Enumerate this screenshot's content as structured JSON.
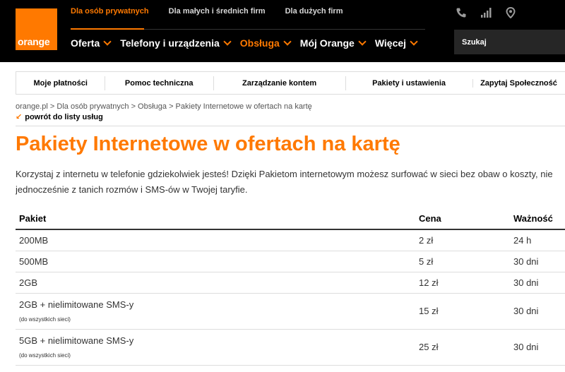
{
  "brand": {
    "logo_text": "orange",
    "color": "#ff7900"
  },
  "segments": [
    {
      "label": "Dla osób prywatnych",
      "active": true
    },
    {
      "label": "Dla małych i średnich firm"
    },
    {
      "label": "Dla dużych firm"
    }
  ],
  "main_nav": [
    {
      "label": "Oferta"
    },
    {
      "label": "Telefony i urządzenia"
    },
    {
      "label": "Obsługa",
      "active": true
    },
    {
      "label": "Mój Orange"
    },
    {
      "label": "Więcej"
    }
  ],
  "utility_icons": [
    "phone-icon",
    "signal-bars-icon",
    "location-pin-icon"
  ],
  "search": {
    "placeholder": "Szukaj"
  },
  "sub_nav": [
    {
      "label": "Moje płatności"
    },
    {
      "label": "Pomoc techniczna"
    },
    {
      "label": "Zarządzanie kontem"
    },
    {
      "label": "Pakiety i ustawienia"
    },
    {
      "label": "Zapytaj Społeczność"
    }
  ],
  "breadcrumb": "orange.pl > Dla osób prywatnych > Obsługa > Pakiety Internetowe w ofertach na kartę",
  "back_link": "powrót do listy usług",
  "page": {
    "title": "Pakiety Internetowe w ofertach na kartę",
    "intro_line1": "Korzystaj z internetu w telefonie gdziekolwiek jesteś! Dzięki Pakietom internetowym możesz surfować w sieci bez obaw o koszty, nie",
    "intro_line2": "jednocześnie z tanich rozmów i SMS-ów w Twojej taryfie."
  },
  "table": {
    "headers": {
      "pakiet": "Pakiet",
      "cena": "Cena",
      "waznosc": "Ważność"
    },
    "rows": [
      {
        "pakiet": "200MB",
        "cena": "2 zł",
        "waznosc": "24 h"
      },
      {
        "pakiet": "500MB",
        "cena": "5 zł",
        "waznosc": "30 dni"
      },
      {
        "pakiet": "2GB",
        "cena": "12 zł",
        "waznosc": "30 dni"
      },
      {
        "pakiet": "2GB + nielimitowane SMS-y",
        "note": "(do wszystkich sieci)",
        "cena": "15 zł",
        "waznosc": "30 dni"
      },
      {
        "pakiet": "5GB + nielimitowane SMS-y",
        "note": "(do wszystkich sieci)",
        "cena": "25 zł",
        "waznosc": "30 dni"
      }
    ]
  }
}
